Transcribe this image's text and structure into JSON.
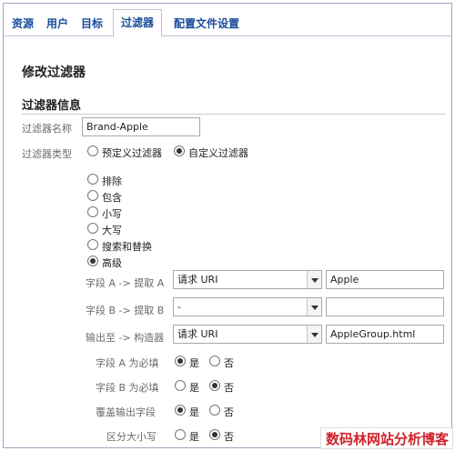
{
  "tabs": [
    {
      "label": "资源",
      "active": false
    },
    {
      "label": "用户",
      "active": false
    },
    {
      "label": "目标",
      "active": false
    },
    {
      "label": "过滤器",
      "active": true
    },
    {
      "label": "配置文件设置",
      "active": false
    }
  ],
  "page_title": "修改过滤器",
  "section_title": "过滤器信息",
  "filter_name": {
    "label": "过滤器名称",
    "value": "Brand-Apple"
  },
  "filter_type": {
    "label": "过滤器类型",
    "options": [
      "预定义过滤器",
      "自定义过滤器"
    ],
    "selected": "自定义过滤器"
  },
  "custom_types": {
    "options": [
      "排除",
      "包含",
      "小写",
      "大写",
      "搜索和替换",
      "高级"
    ],
    "selected": "高级"
  },
  "field_a": {
    "label": "字段 A -> 提取 A",
    "select": "请求 URI",
    "value": "Apple"
  },
  "field_b": {
    "label": "字段 B -> 提取 B",
    "select": "-",
    "value": ""
  },
  "output": {
    "label": "输出至 -> 构造器",
    "select": "请求 URI",
    "value": "AppleGroup.html"
  },
  "yes_label": "是",
  "no_label": "否",
  "toggles": [
    {
      "label": "字段 A 为必填",
      "value": "是"
    },
    {
      "label": "字段 B 为必填",
      "value": "否"
    },
    {
      "label": "覆盖输出字段",
      "value": "是"
    },
    {
      "label": "区分大小写",
      "value": "否"
    }
  ],
  "watermark": "数码林网站分析博客",
  "colors": {
    "tab_text": "#1a4d9c",
    "watermark": "#d0212a"
  }
}
